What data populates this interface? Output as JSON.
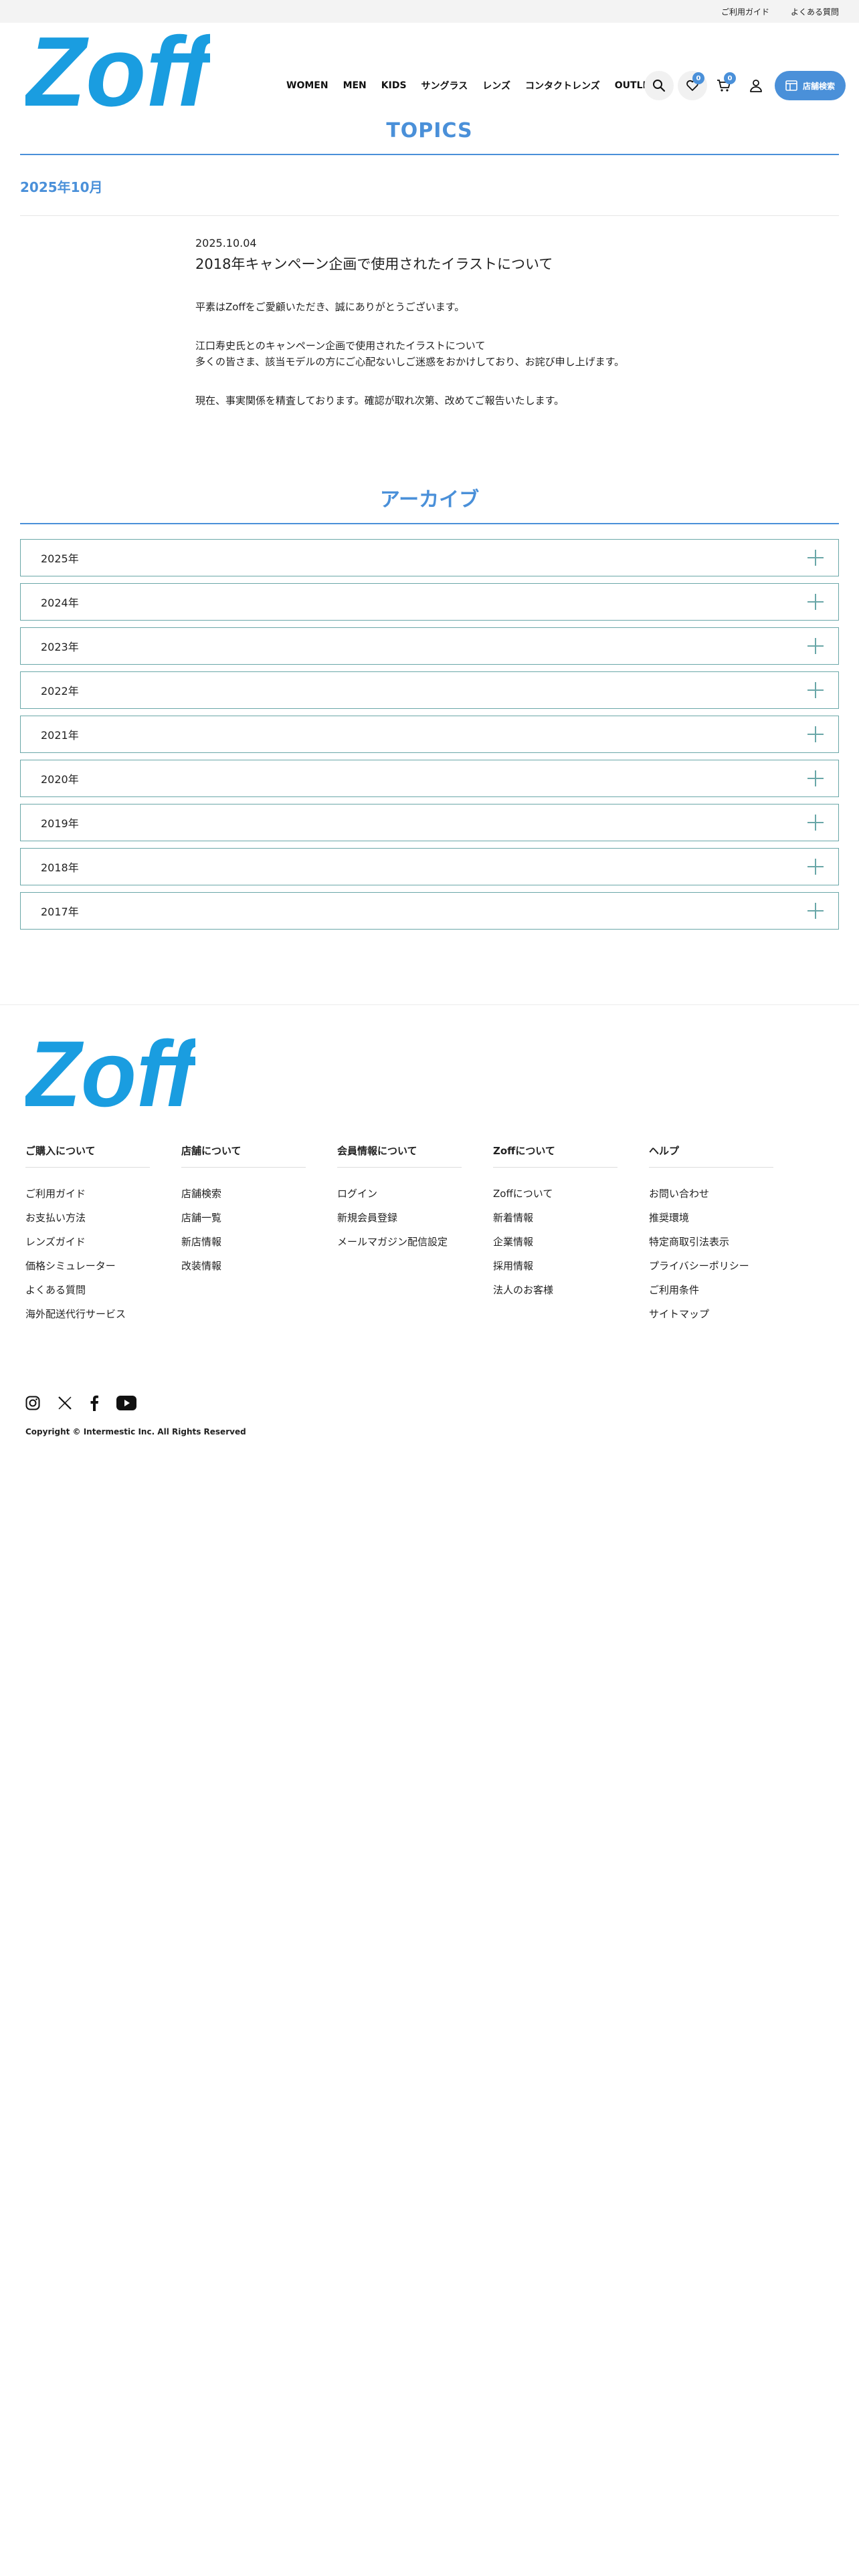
{
  "utility": {
    "guide": "ご利用ガイド",
    "faq": "よくある質問"
  },
  "header": {
    "logo_text": "Zoff",
    "nav": [
      "WOMEN",
      "MEN",
      "KIDS",
      "サングラス",
      "レンズ",
      "コンタクトレンズ",
      "OUTLET"
    ],
    "favorites_count": "0",
    "cart_count": "0",
    "store_button": "店舗検索",
    "icons": [
      "search-icon",
      "heart-icon",
      "cart-icon",
      "user-icon",
      "store-icon"
    ]
  },
  "topics": {
    "title": "TOPICS",
    "month": "2025年10月",
    "article": {
      "date": "2025.10.04",
      "headline": "2018年キャンペーン企画で使用されたイラストについて",
      "paragraphs": [
        "平素はZoffをご愛顧いただき、誠にありがとうございます。",
        "江口寿史氏とのキャンペーン企画で使用されたイラストについて\n多くの皆さま、該当モデルの方にご心配ないしご迷惑をおかけしており、お詫び申し上げます。",
        "現在、事実関係を精査しております。確認が取れ次第、改めてご報告いたします。"
      ]
    }
  },
  "archive": {
    "title": "アーカイブ",
    "years": [
      "2025年",
      "2024年",
      "2023年",
      "2022年",
      "2021年",
      "2020年",
      "2019年",
      "2018年",
      "2017年"
    ]
  },
  "footer": {
    "logo_text": "Zoff",
    "columns": [
      {
        "heading": "ご購入について",
        "links": [
          "ご利用ガイド",
          "お支払い方法",
          "レンズガイド",
          "価格シミュレーター",
          "よくある質問",
          "海外配送代行サービス"
        ]
      },
      {
        "heading": "店舗について",
        "links": [
          "店舗検索",
          "店舗一覧",
          "新店情報",
          "改装情報"
        ]
      },
      {
        "heading": "会員情報について",
        "links": [
          "ログイン",
          "新規会員登録",
          "メールマガジン配信設定"
        ]
      },
      {
        "heading": "Zoffについて",
        "links": [
          "Zoffについて",
          "新着情報",
          "企業情報",
          "採用情報",
          "法人のお客様"
        ]
      },
      {
        "heading": "ヘルプ",
        "links": [
          "お問い合わせ",
          "推奨環境",
          "特定商取引法表示",
          "プライバシーポリシー",
          "ご利用条件",
          "サイトマップ"
        ]
      }
    ],
    "social": [
      "instagram-icon",
      "x-icon",
      "facebook-icon",
      "youtube-icon"
    ],
    "copyright": "Copyright © Intermestic Inc. All Rights Reserved"
  },
  "colors": {
    "brand": "#1a9de0",
    "accent": "#4a90d9",
    "archive_border": "#6aa7a8"
  }
}
